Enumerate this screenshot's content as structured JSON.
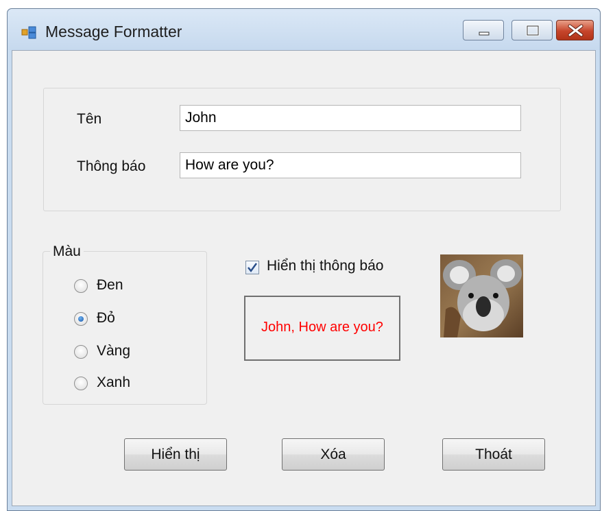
{
  "window": {
    "title": "Message Formatter",
    "controls": {
      "minimize": "minimize",
      "maximize": "maximize",
      "close": "close"
    }
  },
  "form": {
    "name_label": "Tên",
    "name_value": "John",
    "message_label": "Thông báo",
    "message_value": "How are you?"
  },
  "color_group": {
    "legend": "Màu",
    "options": [
      {
        "label": "Đen",
        "selected": false
      },
      {
        "label": "Đỏ",
        "selected": true
      },
      {
        "label": "Vàng",
        "selected": false
      },
      {
        "label": "Xanh",
        "selected": false
      }
    ]
  },
  "show_message": {
    "label": "Hiển thị thông báo",
    "checked": true
  },
  "output": {
    "text": "John, How are you?",
    "color": "#ff0000"
  },
  "image": {
    "subject": "koala"
  },
  "buttons": {
    "show": "Hiển thị",
    "clear": "Xóa",
    "exit": "Thoát"
  }
}
